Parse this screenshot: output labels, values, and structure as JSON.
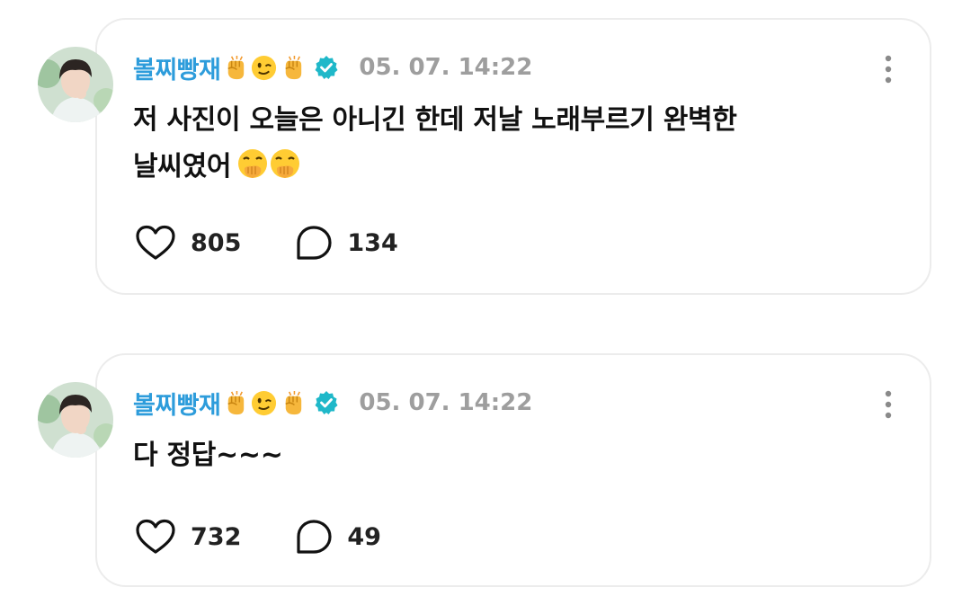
{
  "posts": [
    {
      "username": "볼찌빵재",
      "username_emojis": [
        "raised-fist-emoji",
        "winking-face-emoji",
        "raised-fist-emoji"
      ],
      "verified_icon": "verified-badge-icon",
      "timestamp": "05. 07. 14:22",
      "text_line1": "저 사진이 오늘은 아니긴 한데 저날 노래부르기 완벽한",
      "text_line2": "날씨였어",
      "text_emojis": [
        "face-with-hand-over-mouth-emoji",
        "face-with-hand-over-mouth-emoji"
      ],
      "likes": "805",
      "comments": "134"
    },
    {
      "username": "볼찌빵재",
      "username_emojis": [
        "raised-fist-emoji",
        "winking-face-emoji",
        "raised-fist-emoji"
      ],
      "verified_icon": "verified-badge-icon",
      "timestamp": "05. 07. 14:22",
      "text_line1": "다 정답~~~",
      "likes": "732",
      "comments": "49"
    }
  ],
  "colors": {
    "username": "#2d9cdb",
    "verified": "#1fb8c9",
    "timestamp": "#9e9e9e",
    "card_border": "#ececec"
  }
}
